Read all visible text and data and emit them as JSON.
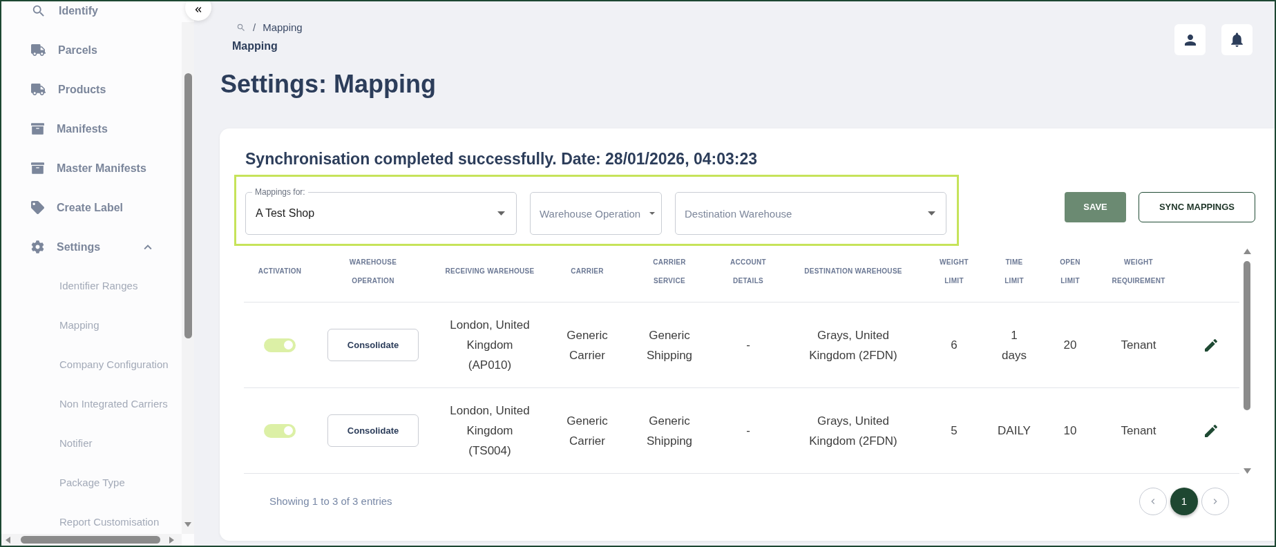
{
  "sidebar": {
    "items": [
      {
        "label": "Identify"
      },
      {
        "label": "Parcels"
      },
      {
        "label": "Products"
      },
      {
        "label": "Manifests"
      },
      {
        "label": "Master Manifests"
      },
      {
        "label": "Create Label"
      },
      {
        "label": "Settings",
        "expanded": true,
        "children": [
          {
            "label": "Identifier Ranges"
          },
          {
            "label": "Mapping"
          },
          {
            "label": "Company Configuration"
          },
          {
            "label": "Non Integrated Carriers"
          },
          {
            "label": "Notifier"
          },
          {
            "label": "Package Type"
          },
          {
            "label": "Report Customisation"
          }
        ]
      }
    ]
  },
  "breadcrumb": {
    "separator": "/",
    "trail": [
      "Mapping"
    ],
    "current": "Mapping"
  },
  "page_title": "Settings: Mapping",
  "card": {
    "message": "Synchronisation completed successfully. Date: 28/01/2026, 04:03:23",
    "filters": [
      {
        "label": "Mappings for:",
        "value": "A Test Shop"
      },
      {
        "placeholder": "Warehouse Operation"
      },
      {
        "placeholder": "Destination Warehouse"
      }
    ],
    "buttons": [
      {
        "label": "SAVE",
        "kind": "primary"
      },
      {
        "label": "SYNC MAPPINGS",
        "kind": "outline"
      }
    ],
    "table": {
      "columns": [
        "ACTIVATION",
        "WAREHOUSE OPERATION",
        "RECEIVING WAREHOUSE",
        "CARRIER",
        "CARRIER SERVICE",
        "ACCOUNT DETAILS",
        "DESTINATION WAREHOUSE",
        "WEIGHT LIMIT",
        "TIME LIMIT",
        "OPEN LIMIT",
        "WEIGHT REQUIREMENT"
      ],
      "rows": [
        {
          "active": true,
          "operation": "Consolidate",
          "receiving_warehouse": "London, United Kingdom (AP010)",
          "carrier": "Generic Carrier",
          "carrier_service": "Generic Shipping",
          "account_details": "-",
          "destination_warehouse": "Grays, United Kingdom (2FDN)",
          "weight_limit": "6",
          "time_limit": "1 days",
          "open_limit": "20",
          "weight_requirement": "Tenant"
        },
        {
          "active": true,
          "operation": "Consolidate",
          "receiving_warehouse": "London, United Kingdom (TS004)",
          "carrier": "Generic Carrier",
          "carrier_service": "Generic Shipping",
          "account_details": "-",
          "destination_warehouse": "Grays, United Kingdom (2FDN)",
          "weight_limit": "5",
          "time_limit": "DAILY",
          "open_limit": "10",
          "weight_requirement": "Tenant"
        }
      ]
    },
    "footer": {
      "summary": "Showing 1 to 3 of 3 entries",
      "pages": [
        {
          "label": "1",
          "selected": true
        }
      ]
    }
  }
}
